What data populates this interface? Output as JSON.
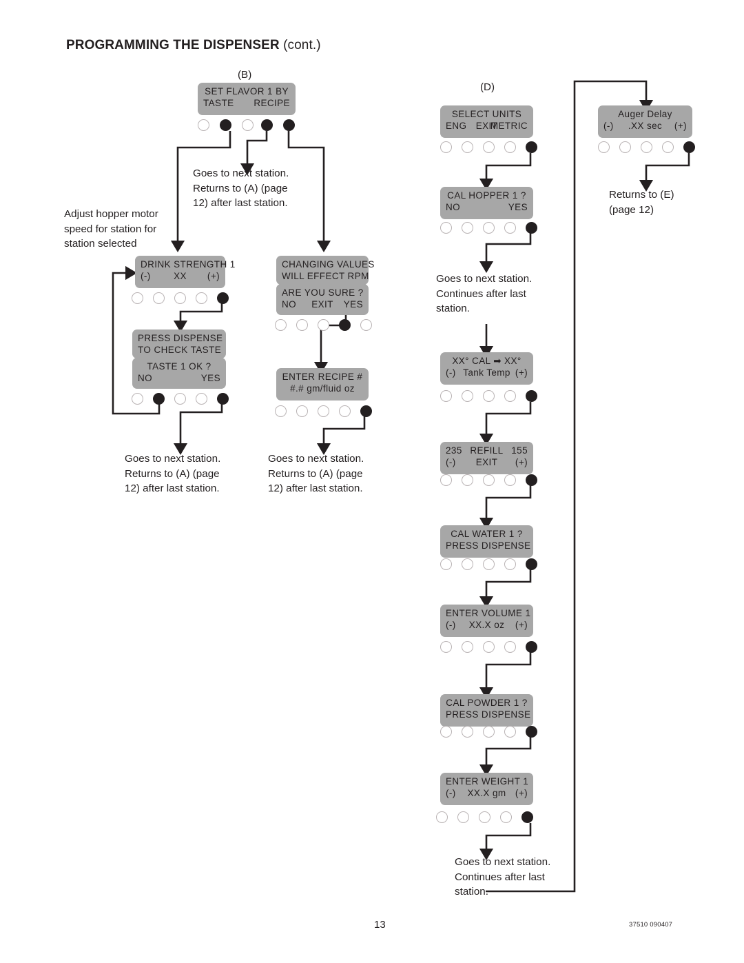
{
  "document": {
    "title_main": "PROGRAMMING THE DISPENSER",
    "title_cont": "(cont.)",
    "page_number": "13",
    "footer_code": "37510 090407"
  },
  "labels": {
    "tag_b": "(B)",
    "tag_d": "(D)"
  },
  "notes": {
    "adjust_hopper": "Adjust hopper motor\nspeed for station for\nstation selected",
    "next_station_returns_a_top": "Goes to next station.\nReturns to (A) (page\n12) after last station.",
    "next_station_returns_a_left": "Goes to next station.\nReturns to (A) (page\n12) after last station.",
    "next_station_returns_a_mid": "Goes to next station.\nReturns to (A) (page\n12) after last station.",
    "next_station_continues_top": "Goes to next station.\nContinues after last\nstation.",
    "next_station_continues_bottom": "Goes to next station.\nContinues after last\nstation.",
    "returns_to_e": "Returns to (E)\n(page 12)"
  },
  "screens": {
    "set_flavor": {
      "name": "set-flavor-screen",
      "lines": [
        {
          "center": "SET  FLAVOR  1  BY"
        },
        {
          "left": "TASTE",
          "right": "RECIPE"
        }
      ],
      "buttons": [
        "off",
        "on",
        "off",
        "on",
        "on"
      ]
    },
    "drink_strength": {
      "name": "drink-strength-screen",
      "lines": [
        {
          "center": "DRINK  STRENGTH   1"
        },
        {
          "left": "(-)",
          "center": "XX",
          "right": "(+)"
        }
      ],
      "buttons": [
        "off",
        "off",
        "off",
        "off",
        "on"
      ]
    },
    "press_dispense_taste": {
      "name": "press-dispense-taste-screen",
      "lines_top": [
        {
          "center": "PRESS  DISPENSE"
        },
        {
          "center": "TO  CHECK  TASTE"
        }
      ],
      "lines_bottom": [
        {
          "center": "TASTE  1  OK  ?"
        },
        {
          "left": "NO",
          "right": "YES"
        }
      ],
      "buttons": [
        "off",
        "on",
        "off",
        "off",
        "on"
      ]
    },
    "changing_values": {
      "name": "changing-values-screen",
      "lines_top": [
        {
          "center": "CHANGING  VALUES"
        },
        {
          "center": "WILL  EFFECT  RPM"
        }
      ],
      "lines_bottom": [
        {
          "center": "ARE  YOU  SURE  ?"
        },
        {
          "left": "NO",
          "center": "EXIT",
          "right": "YES"
        }
      ],
      "buttons": [
        "off",
        "off",
        "off",
        "on",
        "off"
      ]
    },
    "enter_recipe": {
      "name": "enter-recipe-screen",
      "lines": [
        {
          "center": "ENTER  RECIPE  #"
        },
        {
          "center": "#.#  gm/fluid  oz"
        }
      ],
      "buttons": [
        "off",
        "off",
        "off",
        "off",
        "on"
      ]
    },
    "select_units": {
      "name": "select-units-screen",
      "lines": [
        {
          "center": "SELECT  UNITS"
        },
        {
          "left": "ENG",
          "center": "EXIT",
          "right": "METRIC"
        }
      ],
      "buttons": [
        "off",
        "off",
        "off",
        "off",
        "on"
      ]
    },
    "cal_hopper": {
      "name": "cal-hopper-screen",
      "lines": [
        {
          "center": "CAL  HOPPER  1 ?"
        },
        {
          "left": "NO",
          "right": "YES"
        }
      ],
      "buttons": [
        "off",
        "off",
        "off",
        "off",
        "on"
      ]
    },
    "tank_temp": {
      "name": "tank-temp-screen",
      "lines": [
        {
          "center": "XX°  CAL  ➡  XX°"
        },
        {
          "left": "(-)",
          "center": "Tank Temp",
          "right": "(+)"
        }
      ],
      "buttons": [
        "off",
        "off",
        "off",
        "off",
        "on"
      ]
    },
    "refill": {
      "name": "refill-screen",
      "lines": [
        {
          "left": "235",
          "center": "REFILL",
          "right": "155"
        },
        {
          "left": "(-)",
          "center": "EXIT",
          "right": "(+)"
        }
      ],
      "buttons": [
        "off",
        "off",
        "off",
        "off",
        "on"
      ]
    },
    "cal_water": {
      "name": "cal-water-screen",
      "lines": [
        {
          "center": "CAL  WATER  1 ?"
        },
        {
          "center": "PRESS  DISPENSE"
        }
      ],
      "buttons": [
        "off",
        "off",
        "off",
        "off",
        "on"
      ]
    },
    "enter_volume": {
      "name": "enter-volume-screen",
      "lines": [
        {
          "center": "ENTER  VOLUME  1"
        },
        {
          "left": "(-)",
          "center": "XX.X oz",
          "right": "(+)"
        }
      ],
      "buttons": [
        "off",
        "off",
        "off",
        "off",
        "on"
      ]
    },
    "cal_powder": {
      "name": "cal-powder-screen",
      "lines": [
        {
          "center": "CAL  POWDER  1 ?"
        },
        {
          "center": "PRESS  DISPENSE"
        }
      ],
      "buttons": [
        "off",
        "off",
        "off",
        "off",
        "on"
      ]
    },
    "enter_weight": {
      "name": "enter-weight-screen",
      "lines": [
        {
          "center": "ENTER  WEIGHT  1"
        },
        {
          "left": "(-)",
          "center": "XX.X gm",
          "right": "(+)"
        }
      ],
      "buttons": [
        "off",
        "off",
        "off",
        "off",
        "on"
      ]
    },
    "auger_delay": {
      "name": "auger-delay-screen",
      "lines": [
        {
          "center": "Auger   Delay"
        },
        {
          "left": "(-)",
          "center": ".XX sec",
          "right": "(+)"
        }
      ],
      "buttons": [
        "off",
        "off",
        "off",
        "off",
        "on"
      ]
    }
  },
  "colors": {
    "lcd_background": "#a7a7a7",
    "ink": "#231f20",
    "button_off_border": "#b9b3b4",
    "button_on_fill": "#231f20",
    "page_background": "#ffffff"
  }
}
